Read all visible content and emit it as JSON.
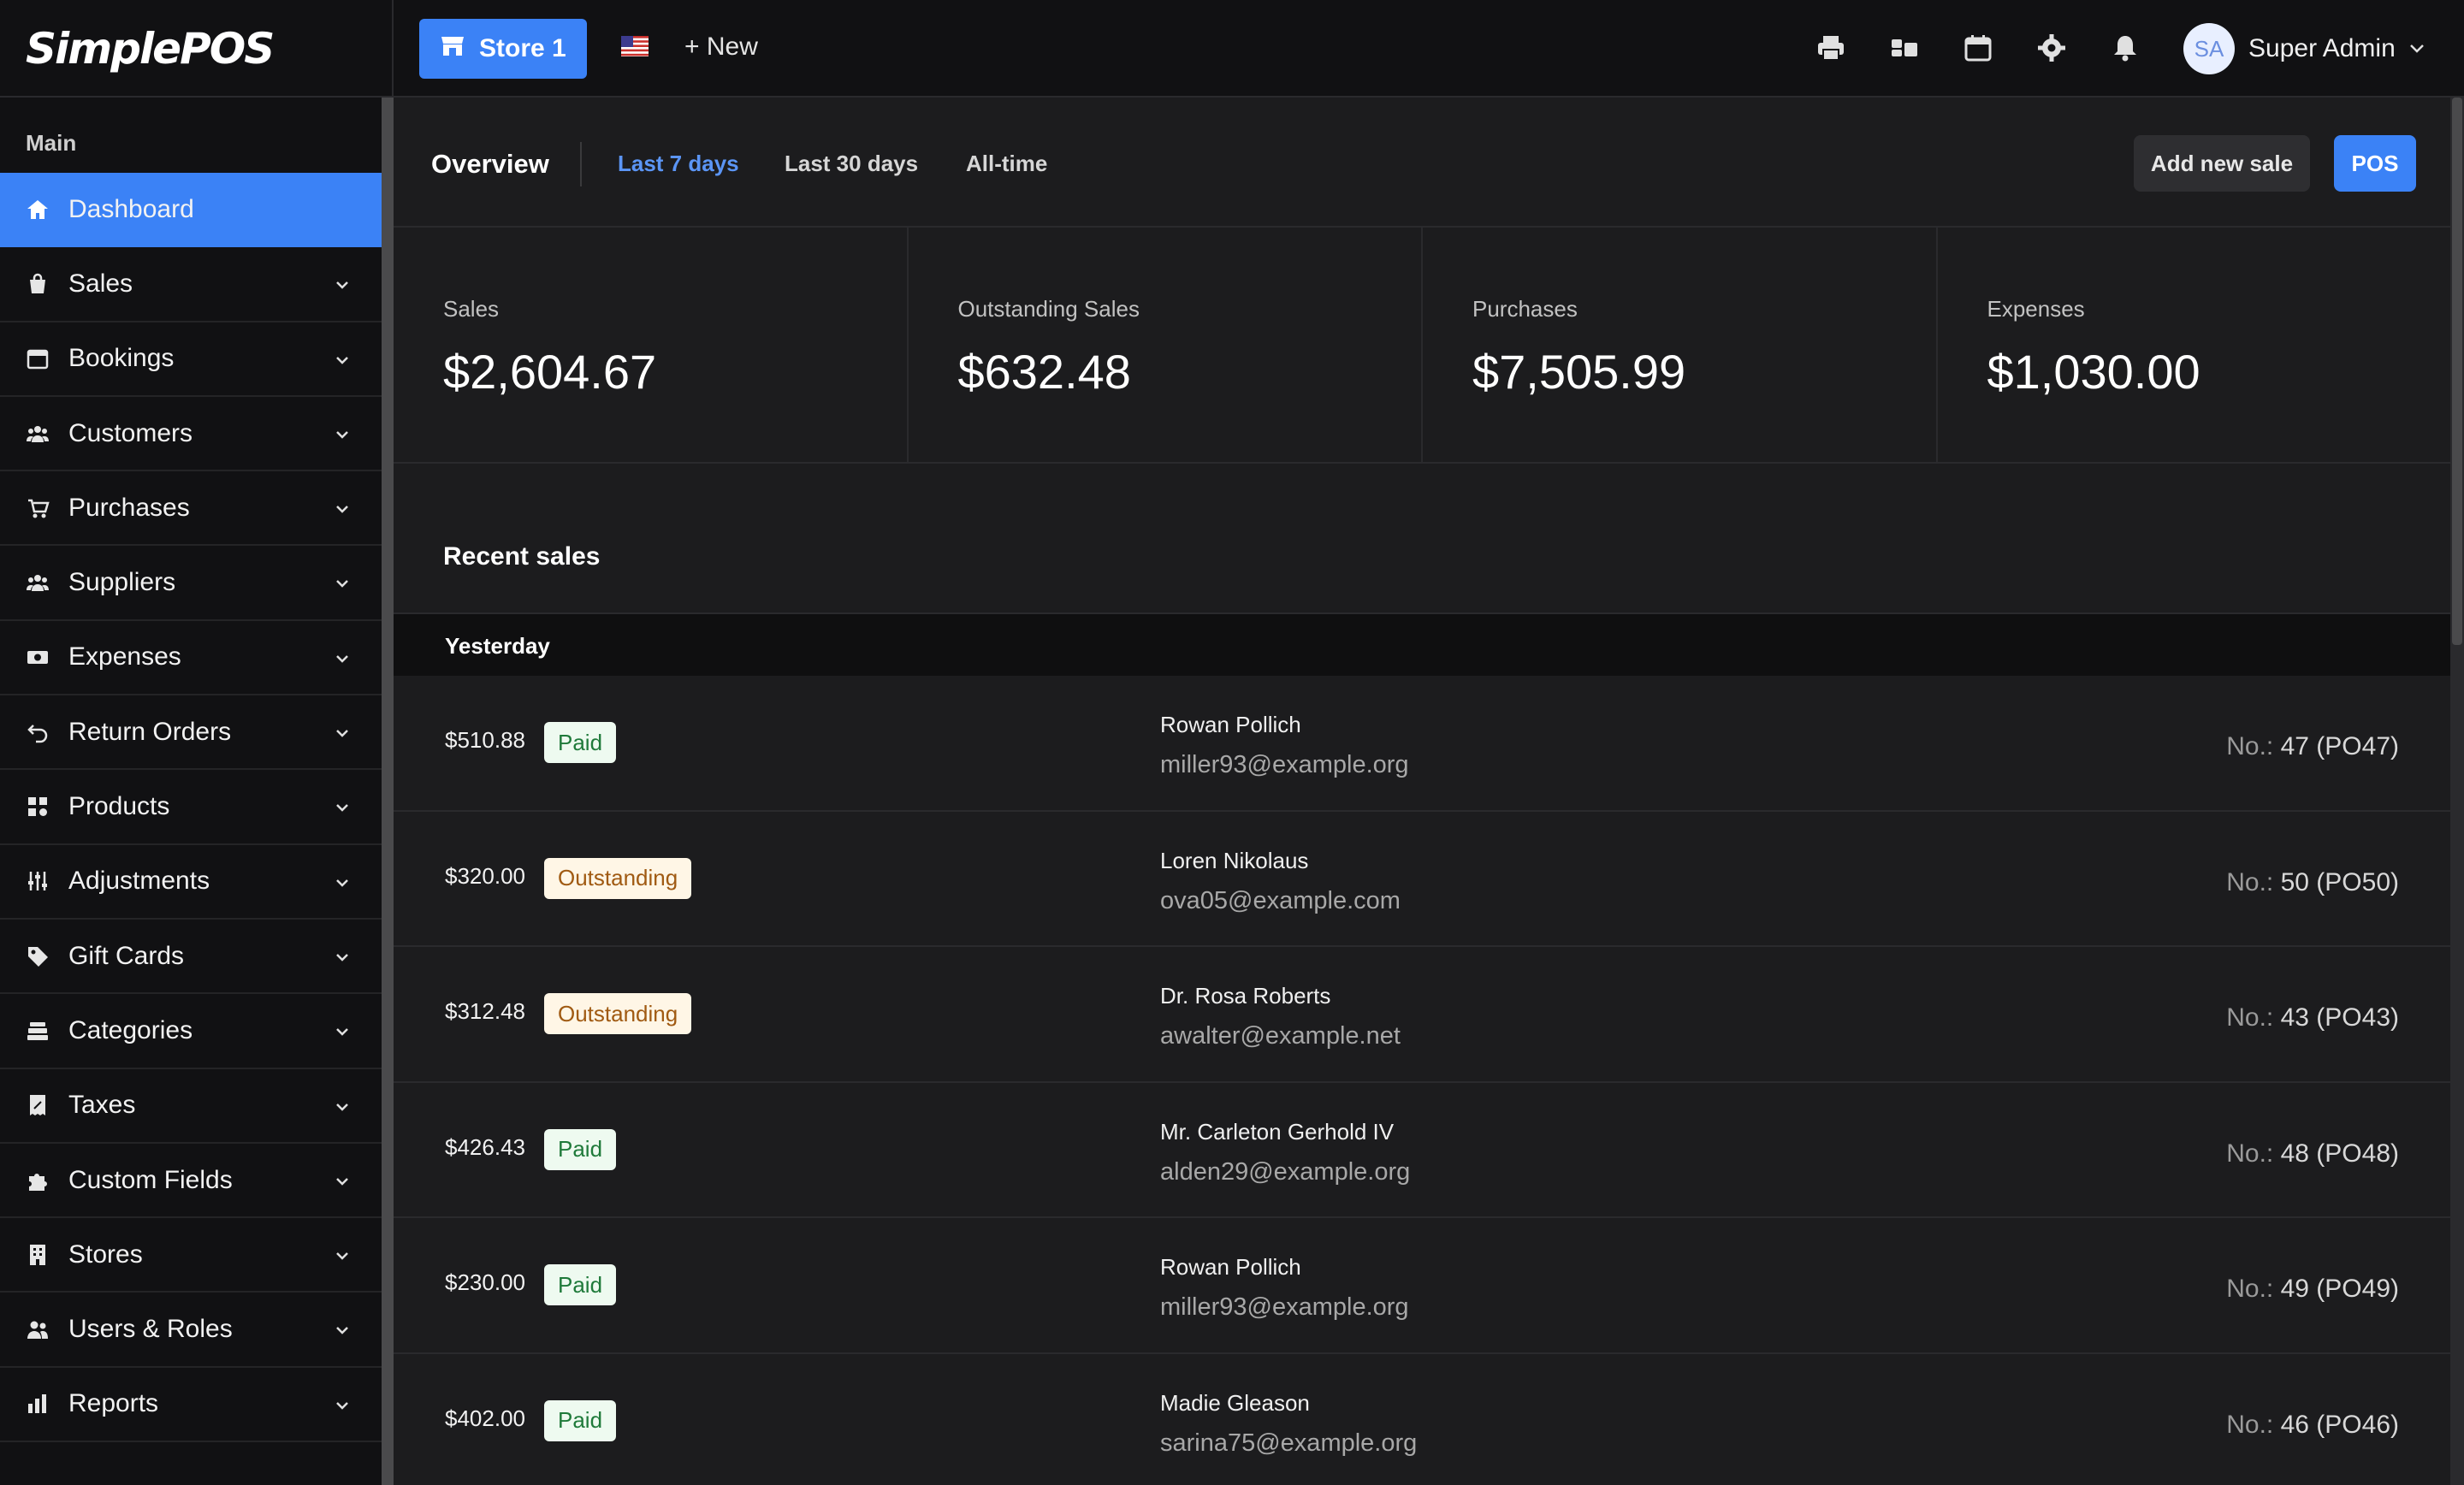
{
  "app": {
    "logo": "SimplePOS"
  },
  "topbar": {
    "store_label": "Store 1",
    "new_label": "+ New",
    "user_initials": "SA",
    "user_name": "Super Admin",
    "icons": [
      "printer-icon",
      "register-icon",
      "calendar-icon",
      "gear-icon",
      "bell-icon"
    ]
  },
  "sidebar": {
    "section_title": "Main",
    "items": [
      {
        "label": "Dashboard",
        "icon": "home-icon",
        "active": true
      },
      {
        "label": "Sales",
        "icon": "bag-icon"
      },
      {
        "label": "Bookings",
        "icon": "calendar-icon"
      },
      {
        "label": "Customers",
        "icon": "users-icon"
      },
      {
        "label": "Purchases",
        "icon": "cart-icon"
      },
      {
        "label": "Suppliers",
        "icon": "users-icon"
      },
      {
        "label": "Expenses",
        "icon": "money-icon"
      },
      {
        "label": "Return Orders",
        "icon": "undo-icon"
      },
      {
        "label": "Products",
        "icon": "grid-icon"
      },
      {
        "label": "Adjustments",
        "icon": "sliders-icon"
      },
      {
        "label": "Gift Cards",
        "icon": "tag-icon"
      },
      {
        "label": "Categories",
        "icon": "layers-icon"
      },
      {
        "label": "Taxes",
        "icon": "receipt-icon"
      },
      {
        "label": "Custom Fields",
        "icon": "puzzle-icon"
      },
      {
        "label": "Stores",
        "icon": "building-icon"
      },
      {
        "label": "Users & Roles",
        "icon": "user-group-icon"
      },
      {
        "label": "Reports",
        "icon": "chart-icon"
      }
    ]
  },
  "overview": {
    "title": "Overview",
    "tabs": [
      "Last 7 days",
      "Last 30 days",
      "All-time"
    ],
    "active_tab": "Last 7 days",
    "add_sale_label": "Add new sale",
    "pos_label": "POS"
  },
  "stats": [
    {
      "label": "Sales",
      "value": "$2,604.67"
    },
    {
      "label": "Outstanding Sales",
      "value": "$632.48"
    },
    {
      "label": "Purchases",
      "value": "$7,505.99"
    },
    {
      "label": "Expenses",
      "value": "$1,030.00"
    }
  ],
  "recent": {
    "title": "Recent sales",
    "group_label": "Yesterday",
    "sales": [
      {
        "amount": "$510.88",
        "status": "Paid",
        "name": "Rowan Pollich",
        "email": "miller93@example.org",
        "ref_label": "No.:",
        "ref": "47 (PO47)"
      },
      {
        "amount": "$320.00",
        "status": "Outstanding",
        "name": "Loren Nikolaus",
        "email": "ova05@example.com",
        "ref_label": "No.:",
        "ref": "50 (PO50)"
      },
      {
        "amount": "$312.48",
        "status": "Outstanding",
        "name": "Dr. Rosa Roberts",
        "email": "awalter@example.net",
        "ref_label": "No.:",
        "ref": "43 (PO43)"
      },
      {
        "amount": "$426.43",
        "status": "Paid",
        "name": "Mr. Carleton Gerhold IV",
        "email": "alden29@example.org",
        "ref_label": "No.:",
        "ref": "48 (PO48)"
      },
      {
        "amount": "$230.00",
        "status": "Paid",
        "name": "Rowan Pollich",
        "email": "miller93@example.org",
        "ref_label": "No.:",
        "ref": "49 (PO49)"
      },
      {
        "amount": "$402.00",
        "status": "Paid",
        "name": "Madie Gleason",
        "email": "sarina75@example.org",
        "ref_label": "No.:",
        "ref": "46 (PO46)"
      }
    ]
  },
  "colors": {
    "accent": "#3b82f6",
    "paid": "#1f7a3a",
    "outstanding": "#a05a12"
  }
}
